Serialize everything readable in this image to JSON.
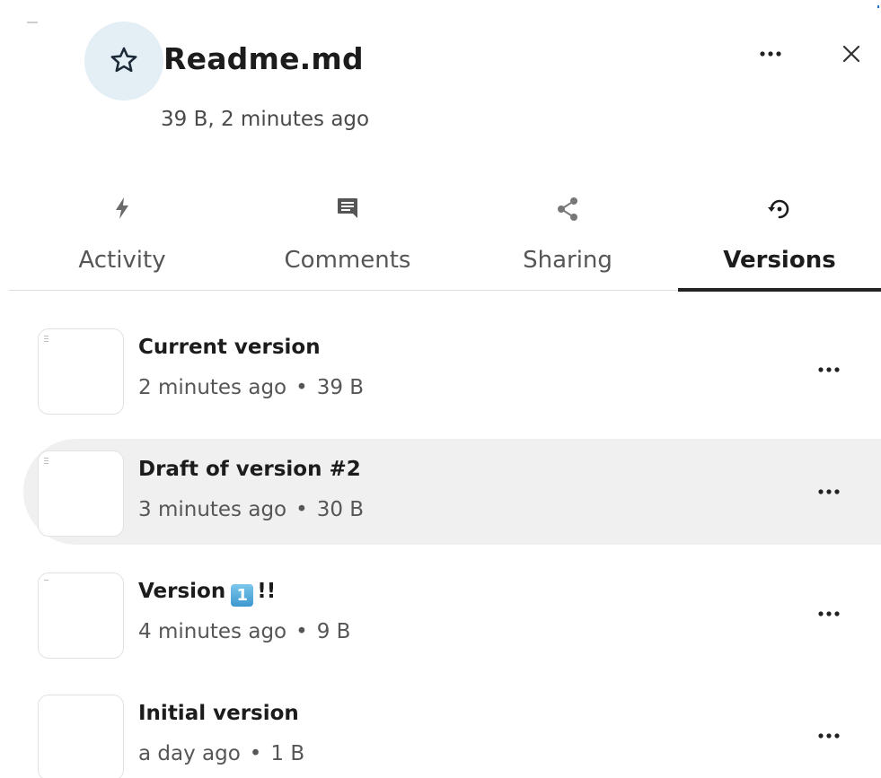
{
  "header": {
    "title": "Readme.md",
    "subtitle": "39 B, 2 minutes ago",
    "favorite_icon": "star-outline-icon",
    "more_icon": "more-horizontal-icon",
    "close_icon": "close-icon"
  },
  "tabs": [
    {
      "label": "Activity",
      "icon": "lightning-icon",
      "active": false
    },
    {
      "label": "Comments",
      "icon": "comment-icon",
      "active": false
    },
    {
      "label": "Sharing",
      "icon": "share-icon",
      "active": false
    },
    {
      "label": "Versions",
      "icon": "history-icon",
      "active": true
    }
  ],
  "versions": [
    {
      "title": "Current version",
      "time": "2 minutes ago",
      "size": "39 B",
      "hovered": false
    },
    {
      "title": "Draft of version #2",
      "time": "3 minutes ago",
      "size": "30 B",
      "hovered": true
    },
    {
      "title_prefix": "Version",
      "title_emoji": "1",
      "title_suffix": "!!",
      "time": "4 minutes ago",
      "size": "9 B",
      "hovered": false
    },
    {
      "title": "Initial version",
      "time": "a day ago",
      "size": "1 B",
      "hovered": false
    }
  ],
  "separator": "•",
  "colors": {
    "favorite_bg": "#e3eef5",
    "hover_bg": "#f0f0f0",
    "active_tab_underline": "#222222",
    "keycap_blue": "#3c97cf"
  }
}
